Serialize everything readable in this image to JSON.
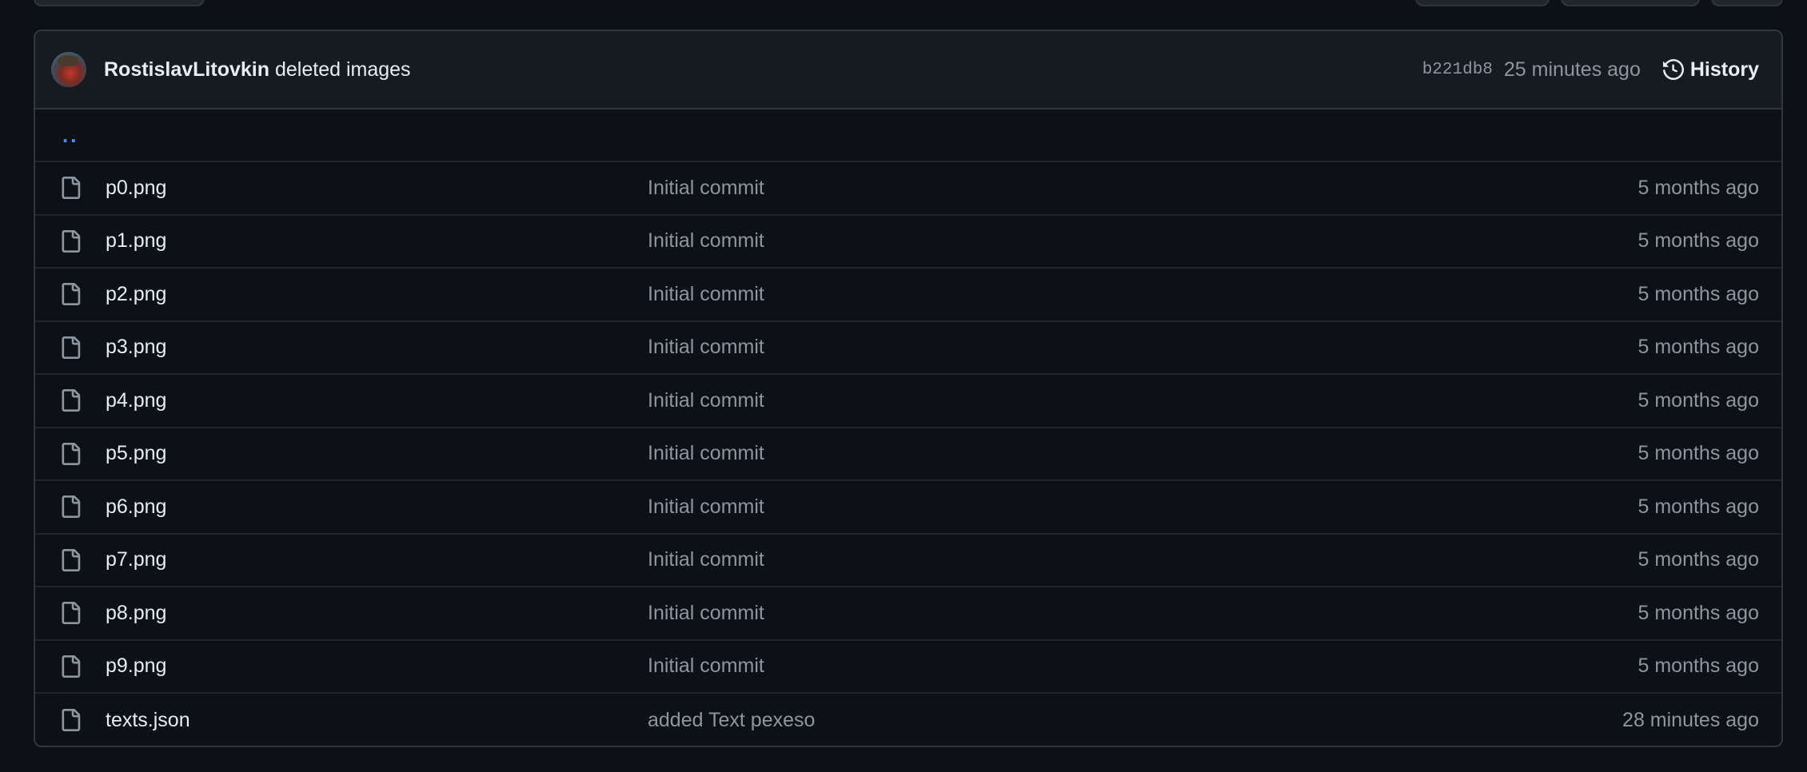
{
  "latest_commit": {
    "author": "RostislavLitovkin",
    "message": "deleted images",
    "sha": "b221db8",
    "time": "25 minutes ago",
    "history_label": "History"
  },
  "parent_dir_label": "..",
  "files": [
    {
      "name": "p0.png",
      "commit": "Initial commit",
      "age": "5 months ago"
    },
    {
      "name": "p1.png",
      "commit": "Initial commit",
      "age": "5 months ago"
    },
    {
      "name": "p2.png",
      "commit": "Initial commit",
      "age": "5 months ago"
    },
    {
      "name": "p3.png",
      "commit": "Initial commit",
      "age": "5 months ago"
    },
    {
      "name": "p4.png",
      "commit": "Initial commit",
      "age": "5 months ago"
    },
    {
      "name": "p5.png",
      "commit": "Initial commit",
      "age": "5 months ago"
    },
    {
      "name": "p6.png",
      "commit": "Initial commit",
      "age": "5 months ago"
    },
    {
      "name": "p7.png",
      "commit": "Initial commit",
      "age": "5 months ago"
    },
    {
      "name": "p8.png",
      "commit": "Initial commit",
      "age": "5 months ago"
    },
    {
      "name": "p9.png",
      "commit": "Initial commit",
      "age": "5 months ago"
    },
    {
      "name": "texts.json",
      "commit": "added Text pexeso",
      "age": "28 minutes ago"
    }
  ],
  "colors": {
    "background": "#0d1117",
    "header_bg": "#161b22",
    "border": "#30363d",
    "text_primary": "#e6edf3",
    "text_muted": "#8d96a0",
    "link": "#4493f8"
  },
  "icons": {
    "history": "history-icon",
    "file": "file-icon"
  }
}
